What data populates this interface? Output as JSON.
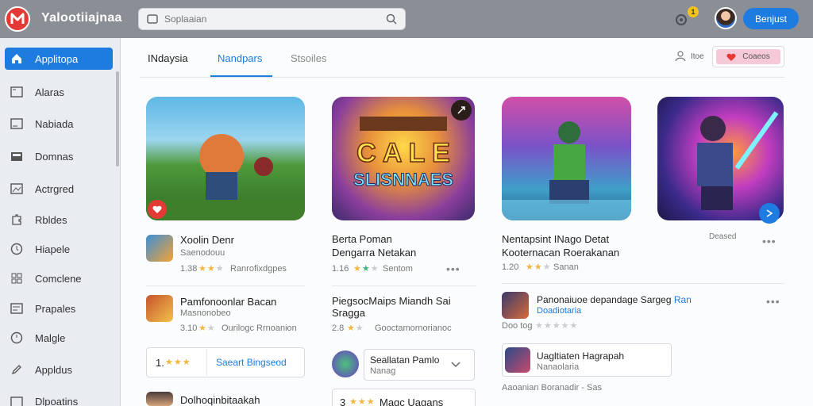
{
  "topbar": {
    "title": "Yalootiiajnaa",
    "search_placeholder": "Soplaaian",
    "notification_count": "1",
    "signin_label": "Benjust"
  },
  "sidebar": {
    "items": [
      {
        "label": "Applitopa",
        "icon": "home-icon",
        "active": true
      },
      {
        "label": "Alaras",
        "icon": "window-icon"
      },
      {
        "label": "Nabiada",
        "icon": "document-icon"
      },
      {
        "label": "Domnas",
        "icon": "folder-icon"
      },
      {
        "label": "Actrgred",
        "icon": "image-icon"
      },
      {
        "label": "Rbldes",
        "icon": "puzzle-icon"
      },
      {
        "label": "Hiapele",
        "icon": "clock-icon"
      },
      {
        "label": "Comclene",
        "icon": "grid-icon"
      },
      {
        "label": "Prapales",
        "icon": "list-icon"
      },
      {
        "label": "Malgle",
        "icon": "clock-icon"
      },
      {
        "label": "Appldus",
        "icon": "pen-icon"
      },
      {
        "label": "Dlpoatins",
        "icon": "download-icon"
      }
    ]
  },
  "tabs": [
    {
      "label": "INdaysia",
      "active": false
    },
    {
      "label": "Nandpars",
      "active": true
    },
    {
      "label": "Stsoiles",
      "active": false
    }
  ],
  "toolbar": {
    "filter_label": "Itoe",
    "pink_button_label": "Coaeos"
  },
  "cards": {
    "c1": {
      "title": "Xoolin Denr",
      "subtitle": "Saenodouu",
      "rating": "1.38",
      "stars": 3,
      "extra": "Ranrofixdgpes"
    },
    "c2": {
      "title": "Berta Poman",
      "subtitle": "Dengarra Netakan",
      "rating": "1.16",
      "stars": 3,
      "extra": "Sentom"
    },
    "c3": {
      "title": "Nentapsint INago Detat",
      "subtitle": "Kooternacan Roerakanan",
      "rating": "1.20",
      "stars": 3,
      "extra": "Sanan"
    },
    "c4": {
      "label": "Deased"
    }
  },
  "row2": {
    "a": {
      "title": "Pamfonoonlar Bacan",
      "subtitle": "Masnonobeo",
      "rating": "3.10",
      "stars": 2,
      "extra": "Ourilogc Rrnoanion"
    },
    "b": {
      "title": "PiegsocMaips Miandh Sai",
      "subtitle": "Sragga",
      "rating": "2.8",
      "stars": 2,
      "extra": "Gooctamornorianoc"
    },
    "c": {
      "title": "Panonaiuoe depandage Sargeg",
      "title_link": "Ran",
      "subtitle": "Doadiotaria",
      "meta": "Doo tog",
      "stars": 3
    }
  },
  "row3": {
    "a": {
      "rating": "1.",
      "stars": 3,
      "button": "Saeart Bingseod"
    },
    "b": {
      "title": "Seallatan Pamlo",
      "subtitle": "Nanag"
    },
    "c": {
      "title": "Uagltiaten Hagrapah",
      "subtitle": "Nanaolaria",
      "footer": "Aaoanian Boranadir - Sas"
    }
  },
  "row4": {
    "a": {
      "title": "Dolhoqinbitaakah"
    },
    "b": {
      "rating": "3",
      "stars": 3,
      "title": "Magc Uagans"
    }
  },
  "colors": {
    "accent": "#1e7be0",
    "brand": "#e53935",
    "star": "#f4b63f"
  }
}
